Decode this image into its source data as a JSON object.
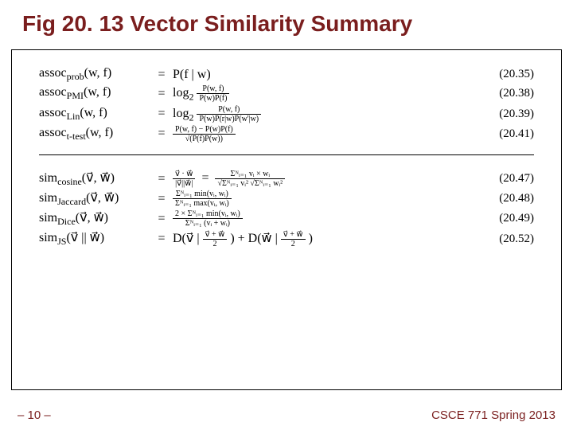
{
  "title": "Fig 20. 13 Vector Similarity Summary",
  "assoc": [
    {
      "name": "assoc",
      "sub": "prob",
      "args": "(w, f)",
      "rhs": "P(f | w)",
      "tag": "(20.35)"
    },
    {
      "name": "assoc",
      "sub": "PMI",
      "args": "(w, f)",
      "rhs_prefix": "log",
      "rhs_sub": "2",
      "frac_num": "P(w, f)",
      "frac_den": "P(w)P(f)",
      "tag": "(20.38)"
    },
    {
      "name": "assoc",
      "sub": "Lin",
      "args": "(w, f)",
      "rhs_prefix": "log",
      "rhs_sub": "2",
      "frac_num": "P(w, f)",
      "frac_den": "P(w)P(r|w)P(w'|w)",
      "tag": "(20.39)"
    },
    {
      "name": "assoc",
      "sub": "t-test",
      "args": "(w, f)",
      "frac_num": "P(w, f) − P(w)P(f)",
      "frac_den": "√(P(f)P(w))",
      "tag": "(20.41)"
    }
  ],
  "sim": [
    {
      "name": "sim",
      "sub": "cosine",
      "args": "(v⃗, w⃗)",
      "mid_num": "v⃗ · w⃗",
      "mid_den": "|v⃗||w⃗|",
      "big_num": "Σᴺᵢ₌₁ vᵢ × wᵢ",
      "big_den": "√Σᴺᵢ₌₁ vᵢ²  √Σᴺᵢ₌₁ wᵢ²",
      "tag": "(20.47)"
    },
    {
      "name": "sim",
      "sub": "Jaccard",
      "args": "(v⃗, w⃗)",
      "big_num": "Σᴺᵢ₌₁ min(vᵢ, wᵢ)",
      "big_den": "Σᴺᵢ₌₁ max(vᵢ, wᵢ)",
      "tag": "(20.48)"
    },
    {
      "name": "sim",
      "sub": "Dice",
      "args": "(v⃗, w⃗)",
      "big_num": "2 × Σᴺᵢ₌₁ min(vᵢ, wᵢ)",
      "big_den": "Σᴺᵢ₌₁ (vᵢ + wᵢ)",
      "tag": "(20.49)"
    },
    {
      "name": "sim",
      "sub": "JS",
      "args": "(v⃗ || w⃗)",
      "rhs_prefix": "D(v⃗ |",
      "mid1_num": "v⃗ + w⃗",
      "mid1_den": "2",
      "rhs_mid": ") + D(w⃗ |",
      "mid2_num": "v⃗ + w⃗",
      "mid2_den": "2",
      "rhs_suffix": ")",
      "tag": "(20.52)"
    }
  ],
  "footer": {
    "left": "– 10 –",
    "right": "CSCE 771 Spring 2013"
  }
}
